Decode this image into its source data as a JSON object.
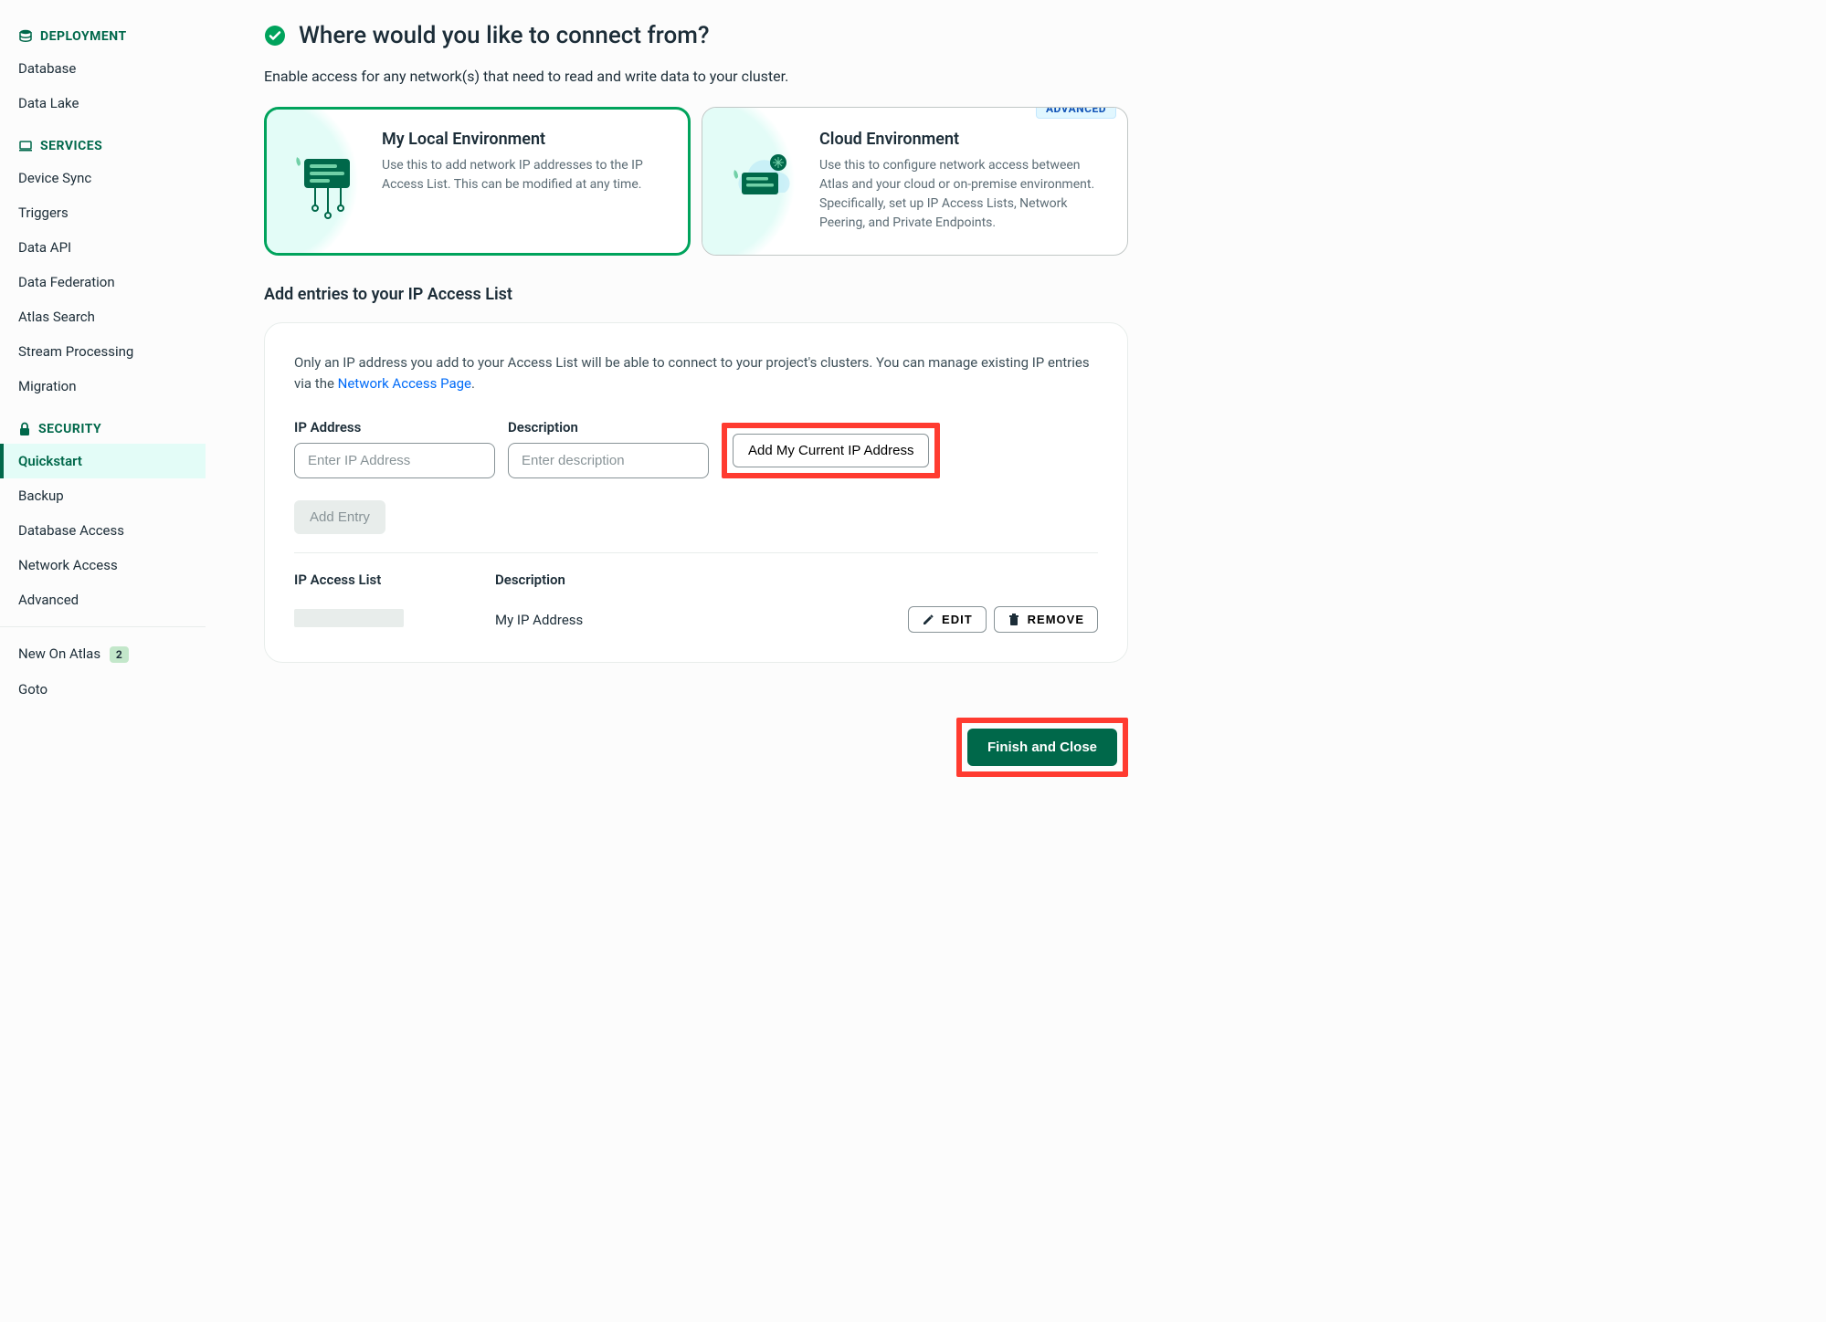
{
  "sidebar": {
    "sections": [
      {
        "key": "deployment",
        "label": "DEPLOYMENT",
        "icon": "database-stack-icon",
        "items": [
          {
            "key": "database",
            "label": "Database"
          },
          {
            "key": "data-lake",
            "label": "Data Lake"
          }
        ]
      },
      {
        "key": "services",
        "label": "SERVICES",
        "icon": "laptop-icon",
        "items": [
          {
            "key": "device-sync",
            "label": "Device Sync"
          },
          {
            "key": "triggers",
            "label": "Triggers"
          },
          {
            "key": "data-api",
            "label": "Data API"
          },
          {
            "key": "data-federation",
            "label": "Data Federation"
          },
          {
            "key": "atlas-search",
            "label": "Atlas Search"
          },
          {
            "key": "stream-processing",
            "label": "Stream Processing"
          },
          {
            "key": "migration",
            "label": "Migration"
          }
        ]
      },
      {
        "key": "security",
        "label": "SECURITY",
        "icon": "lock-icon",
        "items": [
          {
            "key": "quickstart",
            "label": "Quickstart",
            "active": true
          },
          {
            "key": "backup",
            "label": "Backup"
          },
          {
            "key": "database-access",
            "label": "Database Access"
          },
          {
            "key": "network-access",
            "label": "Network Access"
          },
          {
            "key": "advanced",
            "label": "Advanced"
          }
        ]
      }
    ],
    "footer": {
      "new_on_atlas": {
        "label": "New On Atlas",
        "count": "2"
      },
      "goto": {
        "label": "Goto"
      }
    }
  },
  "main": {
    "title": "Where would you like to connect from?",
    "subtext": "Enable access for any network(s) that need to read and write data to your cluster.",
    "options": [
      {
        "key": "local",
        "title": "My Local Environment",
        "desc": "Use this to add network IP addresses to the IP Access List. This can be modified at any time.",
        "selected": true
      },
      {
        "key": "cloud",
        "title": "Cloud Environment",
        "desc": "Use this to configure network access between Atlas and your cloud or on-premise environment. Specifically, set up IP Access Lists, Network Peering, and Private Endpoints.",
        "badge": "ADVANCED"
      }
    ],
    "access_list": {
      "heading": "Add entries to your IP Access List",
      "info_prefix": "Only an IP address you add to your Access List will be able to connect to your project's clusters. You can manage existing IP entries via the ",
      "info_link": "Network Access Page",
      "info_suffix": ".",
      "ip_label": "IP Address",
      "ip_placeholder": "Enter IP Address",
      "desc_label": "Description",
      "desc_placeholder": "Enter description",
      "add_current_btn": "Add My Current IP Address",
      "add_entry_btn": "Add Entry",
      "table": {
        "col_ip": "IP Access List",
        "col_desc": "Description",
        "rows": [
          {
            "ip_masked": true,
            "desc": "My IP Address"
          }
        ],
        "edit_btn": "EDIT",
        "remove_btn": "REMOVE"
      }
    },
    "finish_btn": "Finish and Close"
  }
}
